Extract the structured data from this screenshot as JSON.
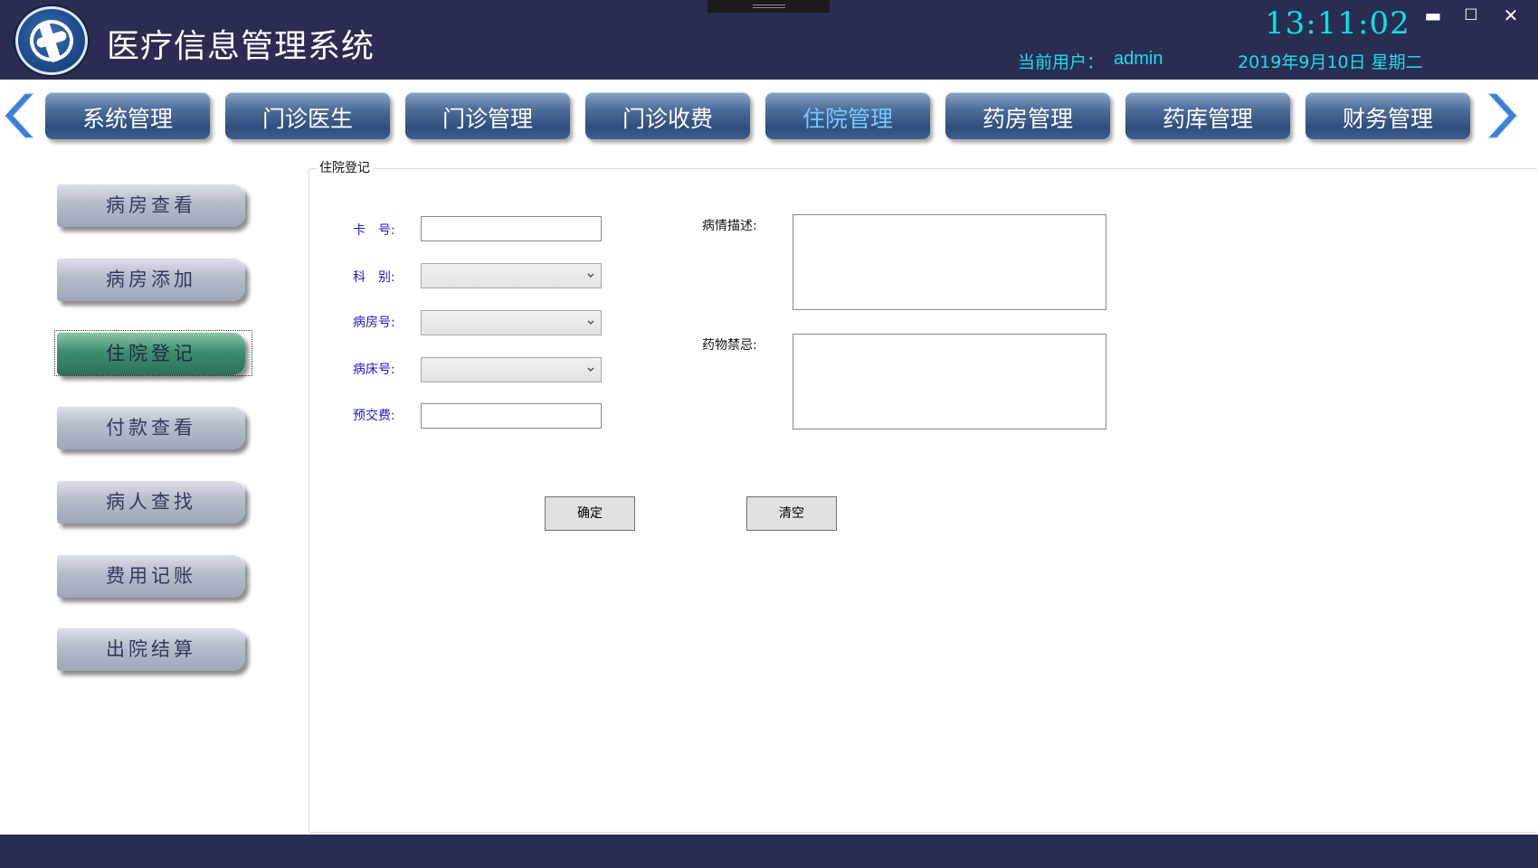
{
  "header": {
    "title": "医疗信息管理系统",
    "clock": "13:11:02",
    "user_label": "当前用户：",
    "user_name": "admin",
    "date": "2019年9月10日 星期二",
    "window_controls": {
      "minimize": "▬",
      "maximize": "☐",
      "close": "✕"
    },
    "logo_icon": "medical-logo-icon"
  },
  "nav": {
    "tabs": [
      {
        "label": "系统管理"
      },
      {
        "label": "门诊医生"
      },
      {
        "label": "门诊管理"
      },
      {
        "label": "门诊收费"
      },
      {
        "label": "住院管理"
      },
      {
        "label": "药房管理"
      },
      {
        "label": "药库管理"
      },
      {
        "label": "财务管理"
      }
    ],
    "active_index": 4,
    "left_arrow_icon": "chevron-left-icon",
    "right_arrow_icon": "chevron-right-icon"
  },
  "sidebar": {
    "items": [
      {
        "label": "病房查看"
      },
      {
        "label": "病房添加"
      },
      {
        "label": "住院登记"
      },
      {
        "label": "付款查看"
      },
      {
        "label": "病人查找"
      },
      {
        "label": "费用记账"
      },
      {
        "label": "出院结算"
      }
    ],
    "active_index": 2
  },
  "form": {
    "group_title": "住院登记",
    "card_label": "卡　号:",
    "card_value": "",
    "department_label": "科　别:",
    "department_value": "",
    "ward_label": "病房号:",
    "ward_value": "",
    "bed_label": "病床号:",
    "bed_value": "",
    "prepay_label": "预交费:",
    "prepay_value": "",
    "condition_label": "病情描述:",
    "condition_value": "",
    "allergy_label": "药物禁忌:",
    "allergy_value": "",
    "confirm_label": "确定",
    "clear_label": "清空"
  },
  "colors": {
    "header_bg": "#2a2c52",
    "accent_cyan": "#14e0e8",
    "field_label_blue": "#1a1ad6",
    "active_tab_text": "#76c8ff",
    "active_side_green": "#3e8f72"
  }
}
